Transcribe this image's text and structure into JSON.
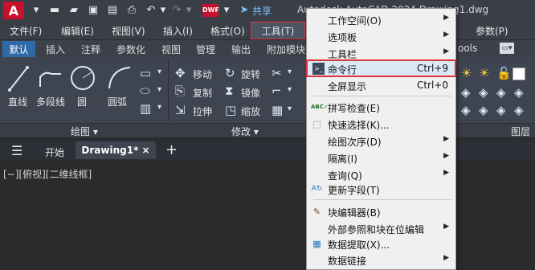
{
  "qat": {
    "logo": "A",
    "share": "共享",
    "title": "Autodesk AutoCAD 2024   Drawing1.dwg",
    "icons": [
      "new-icon",
      "open-icon",
      "save-icon",
      "save-as-icon",
      "print-icon",
      "undo-icon",
      "redo-icon",
      "dwf-icon",
      "dropdown-icon",
      "share-icon"
    ]
  },
  "menubar": {
    "items": [
      "文件(F)",
      "编辑(E)",
      "视图(V)",
      "插入(I)",
      "格式(O)",
      "工具(T)",
      "参数(P)"
    ],
    "right_icons": [
      "minimize-icon",
      "restore-icon",
      "close-icon"
    ]
  },
  "ribbon_tabs": {
    "items": [
      "默认",
      "插入",
      "注释",
      "参数化",
      "视图",
      "管理",
      "输出",
      "附加模块",
      "ools"
    ]
  },
  "ribbon": {
    "draw": [
      "直线",
      "多段线",
      "圆",
      "圆弧"
    ],
    "modify": [
      "移动",
      "旋转",
      "复制",
      "镜像",
      "拉伸",
      "缩放"
    ],
    "panels": [
      "绘图",
      "修改",
      "图层"
    ]
  },
  "filetabs": {
    "home": "开始",
    "drawing": "Drawing1*",
    "add": "+"
  },
  "viewport_label": "[−][俯视][二维线框]",
  "dropdown": {
    "items": [
      {
        "label": "工作空间(O)",
        "arrow": "▶"
      },
      {
        "label": "选项板",
        "arrow": "▶"
      },
      {
        "label": "工具栏",
        "arrow": "▶"
      },
      {
        "label": "命令行",
        "shortcut": "Ctrl+9"
      },
      {
        "label": "全屏显示",
        "shortcut": "Ctrl+0"
      },
      {
        "label": "拼写检查(E)"
      },
      {
        "label": "快速选择(K)..."
      },
      {
        "label": "绘图次序(D)",
        "arrow": "▶"
      },
      {
        "label": "隔离(I)",
        "arrow": "▶"
      },
      {
        "label": "查询(Q)",
        "arrow": "▶"
      },
      {
        "label": "更新字段(T)"
      },
      {
        "label": "块编辑器(B)"
      },
      {
        "label": "外部参照和块在位编辑",
        "arrow": "▶"
      },
      {
        "label": "数据提取(X)..."
      },
      {
        "label": "数据链接",
        "arrow": "▶"
      }
    ]
  }
}
